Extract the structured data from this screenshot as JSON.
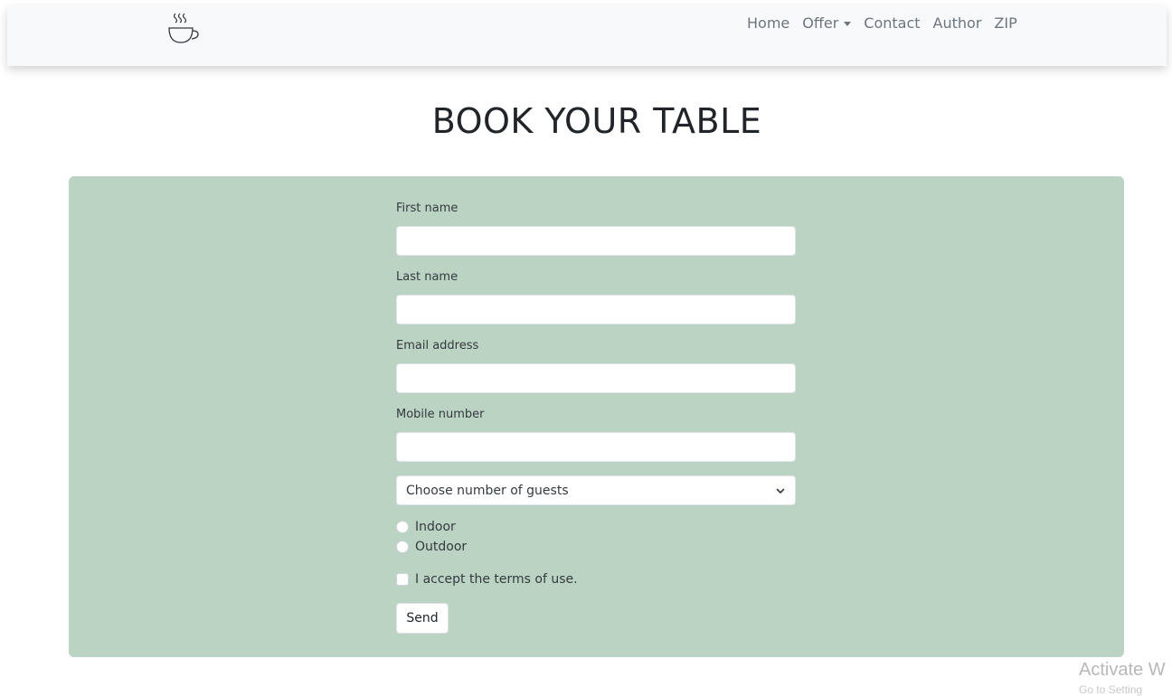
{
  "nav": {
    "logo_icon": "coffee-cup-icon",
    "links": [
      {
        "label": "Home"
      },
      {
        "label": "Offer",
        "icon": "caret-down-icon"
      },
      {
        "label": "Contact"
      },
      {
        "label": "Author"
      },
      {
        "label": "ZIP"
      }
    ]
  },
  "page": {
    "title": "BOOK YOUR TABLE"
  },
  "form": {
    "panel_color": "#bad3c2",
    "first_name_label": "First name",
    "first_name_value": "",
    "last_name_label": "Last name",
    "last_name_value": "",
    "email_label": "Email address",
    "email_value": "",
    "mobile_label": "Mobile number",
    "mobile_value": "",
    "guests_select": "Choose number of guests",
    "guests_icon": "chevron-down-icon",
    "seating_options": [
      "Indoor",
      "Outdoor"
    ],
    "terms_label": "I accept the terms of use.",
    "terms_checked": false,
    "send_label": "Send"
  },
  "system": {
    "activation_watermark": "Activate W",
    "activation_sub": "Go to Setting"
  }
}
